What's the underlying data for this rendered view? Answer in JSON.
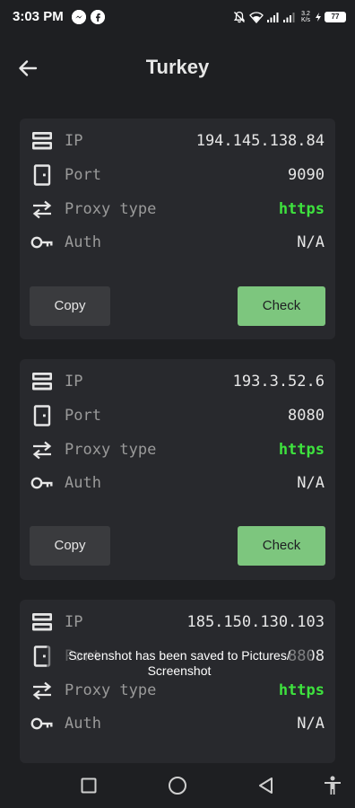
{
  "status_bar": {
    "time": "3:03 PM",
    "notification_icons": [
      "messenger-icon",
      "facebook-icon"
    ],
    "battery_level": "77",
    "net_speed_top": "3.2",
    "net_speed_bottom": "K/s"
  },
  "header": {
    "title": "Turkey",
    "back_icon": "arrow-left-icon"
  },
  "labels": {
    "ip": "IP",
    "port": "Port",
    "proxy_type": "Proxy type",
    "auth": "Auth",
    "copy": "Copy",
    "check": "Check"
  },
  "proxies": [
    {
      "ip": "194.145.138.84",
      "port": "9090",
      "proxy_type": "https",
      "auth": "N/A"
    },
    {
      "ip": "193.3.52.6",
      "port": "8080",
      "proxy_type": "https",
      "auth": "N/A"
    },
    {
      "ip": "185.150.130.103",
      "port": "8808",
      "proxy_type": "https",
      "auth": "N/A"
    }
  ],
  "toast": {
    "line1": "Screenshot has been saved to  Pictures/",
    "line2": "Screenshot"
  },
  "nav_bar": {
    "icons": [
      "recents-square-icon",
      "home-circle-icon",
      "back-triangle-icon",
      "accessibility-icon"
    ]
  },
  "colors": {
    "background": "#1e1f22",
    "card": "#28292d",
    "https_green": "#3ee23e",
    "check_button": "#7dc67e",
    "copy_button": "#3a3b3e"
  }
}
